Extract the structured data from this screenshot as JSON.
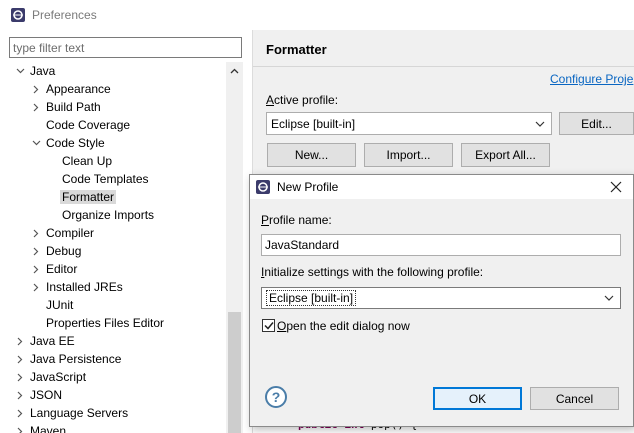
{
  "window": {
    "title": "Preferences",
    "icon": "eclipse-icon"
  },
  "left": {
    "filter_placeholder": "type filter text",
    "tree": [
      {
        "label": "Java",
        "level": 0,
        "arrow": "expanded"
      },
      {
        "label": "Appearance",
        "level": 1,
        "arrow": "collapsed"
      },
      {
        "label": "Build Path",
        "level": 1,
        "arrow": "collapsed"
      },
      {
        "label": "Code Coverage",
        "level": 1,
        "arrow": "none"
      },
      {
        "label": "Code Style",
        "level": 1,
        "arrow": "expanded"
      },
      {
        "label": "Clean Up",
        "level": 2,
        "arrow": "none"
      },
      {
        "label": "Code Templates",
        "level": 2,
        "arrow": "none"
      },
      {
        "label": "Formatter",
        "level": 2,
        "arrow": "none",
        "selected": true
      },
      {
        "label": "Organize Imports",
        "level": 2,
        "arrow": "none"
      },
      {
        "label": "Compiler",
        "level": 1,
        "arrow": "collapsed"
      },
      {
        "label": "Debug",
        "level": 1,
        "arrow": "collapsed"
      },
      {
        "label": "Editor",
        "level": 1,
        "arrow": "collapsed"
      },
      {
        "label": "Installed JREs",
        "level": 1,
        "arrow": "collapsed"
      },
      {
        "label": "JUnit",
        "level": 1,
        "arrow": "none"
      },
      {
        "label": "Properties Files Editor",
        "level": 1,
        "arrow": "none"
      },
      {
        "label": "Java EE",
        "level": 0,
        "arrow": "collapsed"
      },
      {
        "label": "Java Persistence",
        "level": 0,
        "arrow": "collapsed"
      },
      {
        "label": "JavaScript",
        "level": 0,
        "arrow": "collapsed"
      },
      {
        "label": "JSON",
        "level": 0,
        "arrow": "collapsed"
      },
      {
        "label": "Language Servers",
        "level": 0,
        "arrow": "collapsed"
      },
      {
        "label": "Maven",
        "level": 0,
        "arrow": "collapsed"
      }
    ]
  },
  "right": {
    "heading": "Formatter",
    "configure_link": "Configure Proje",
    "active_profile_label": "Active profile:",
    "active_profile_value": "Eclipse [built-in]",
    "edit_button": "Edit...",
    "new_button": "New...",
    "import_button": "Import...",
    "export_button": "Export All..."
  },
  "preview": {
    "keyword1": "public",
    "keyword2": "int",
    "rest": " pop() {"
  },
  "dialog": {
    "title": "New Profile",
    "profile_name_label": "Profile name:",
    "profile_name_value": "JavaStandard",
    "init_label": "Initialize settings with the following profile:",
    "init_value": "Eclipse [built-in]",
    "checkbox_label": "Open the edit dialog now",
    "checkbox_checked": true,
    "ok_button": "OK",
    "cancel_button": "Cancel",
    "help_icon": "?"
  }
}
